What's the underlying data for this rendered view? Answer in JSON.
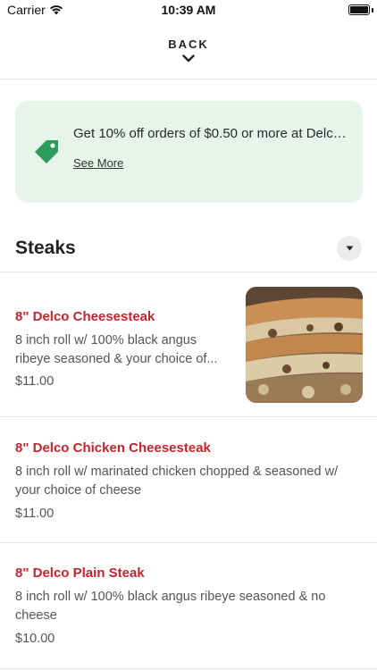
{
  "status_bar": {
    "carrier": "Carrier",
    "time": "10:39 AM",
    "battery_level": 1.0
  },
  "header": {
    "back_label": "BACK"
  },
  "promo": {
    "text": "Get 10% off orders of $0.50 or more at Delco...",
    "link_label": "See More",
    "icon": "price-tag-icon",
    "bg_color": "#e6f4ec",
    "icon_color": "#2e9b5c"
  },
  "section": {
    "title": "Steaks",
    "toggle_icon": "caret-down-icon"
  },
  "menu_items": [
    {
      "name": "8\" Delco Cheesesteak",
      "description_line1": "8 inch roll w/ 100% black angus",
      "description_line2": "ribeye seasoned & your choice of...",
      "price": "$11.00",
      "has_photo": true
    },
    {
      "name": "8\" Delco Chicken Cheesesteak",
      "description_line1": "8 inch roll w/ marinated chicken chopped & seasoned w/",
      "description_line2": "your choice of cheese",
      "price": "$11.00",
      "has_photo": false
    },
    {
      "name": "8\" Delco Plain Steak",
      "description_line1": "8 inch roll w/ 100% black angus ribeye seasoned & no",
      "description_line2": "cheese",
      "price": "$10.00",
      "has_photo": false
    }
  ],
  "colors": {
    "item_name": "#c0262d",
    "body_text": "#555555"
  }
}
